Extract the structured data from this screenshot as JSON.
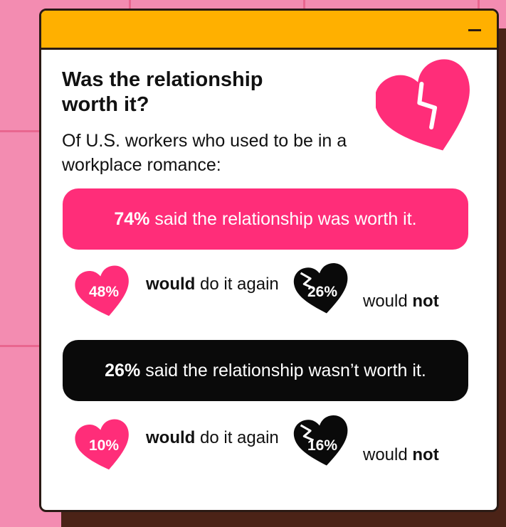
{
  "colors": {
    "background": "#f38cb1",
    "titlebar": "#ffb000",
    "accent_pink": "#ff2d79",
    "black": "#0a0a0a",
    "shadow": "#4b2317"
  },
  "window": {
    "minimize_icon": "minus-icon"
  },
  "headline": "Was the relationship worth it?",
  "subhead": "Of U.S. workers who used to be in a workplace romance:",
  "worth_it": {
    "percent": "74%",
    "text": "said the relationship was worth it.",
    "would_again": {
      "percent": "48%",
      "bold": "would",
      "rest": "do it again"
    },
    "would_not": {
      "percent": "26%",
      "prefix": "would",
      "bold": "not"
    }
  },
  "not_worth_it": {
    "percent": "26%",
    "text": "said the relationship wasn’t worth it.",
    "would_again": {
      "percent": "10%",
      "bold": "would",
      "rest": "do it again"
    },
    "would_not": {
      "percent": "16%",
      "prefix": "would",
      "bold": "not"
    }
  }
}
